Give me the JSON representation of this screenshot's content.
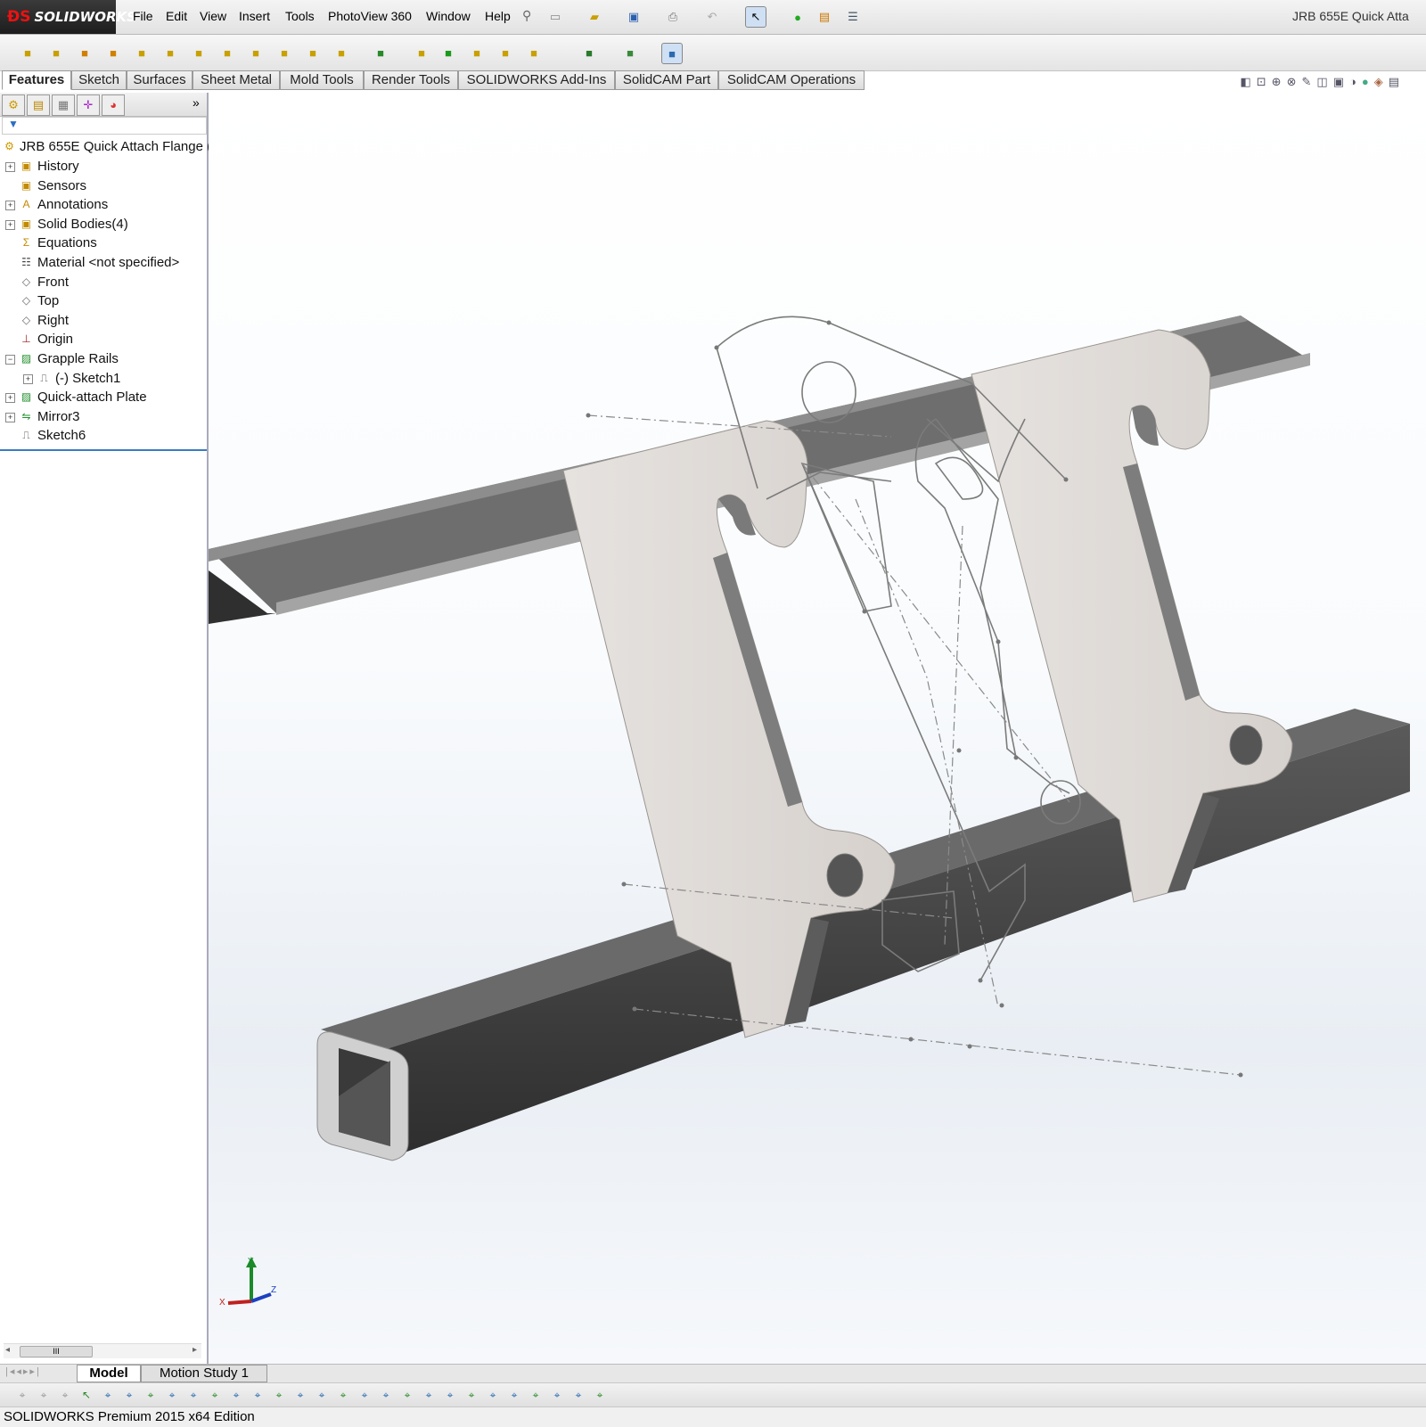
{
  "app": {
    "brand": "SOLIDWORKS",
    "document_title": "JRB 655E Quick Atta"
  },
  "menu": [
    "File",
    "Edit",
    "View",
    "Insert",
    "Tools",
    "PhotoView 360",
    "Window",
    "Help"
  ],
  "command_tabs": [
    "Features",
    "Sketch",
    "Surfaces",
    "Sheet Metal",
    "Mold Tools",
    "Render Tools",
    "SOLIDWORKS Add-Ins",
    "SolidCAM Part",
    "SolidCAM Operations"
  ],
  "feature_tree": {
    "root": "JRB 655E Quick Attach Flange  (",
    "items": [
      {
        "label": "History",
        "icon": "history-folder-icon"
      },
      {
        "label": "Sensors",
        "icon": "sensors-folder-icon"
      },
      {
        "label": "Annotations",
        "icon": "annotations-folder-icon"
      },
      {
        "label": "Solid Bodies(4)",
        "icon": "solid-bodies-folder-icon"
      },
      {
        "label": "Equations",
        "icon": "equations-folder-icon"
      },
      {
        "label": "Material <not specified>",
        "icon": "material-icon"
      },
      {
        "label": "Front",
        "icon": "plane-icon"
      },
      {
        "label": "Top",
        "icon": "plane-icon"
      },
      {
        "label": "Right",
        "icon": "plane-icon"
      },
      {
        "label": "Origin",
        "icon": "origin-icon"
      },
      {
        "label": "Grapple Rails",
        "icon": "feature-icon"
      },
      {
        "label": "(-) Sketch1",
        "icon": "sketch-icon"
      },
      {
        "label": "Quick-attach Plate",
        "icon": "feature-icon"
      },
      {
        "label": "Mirror3",
        "icon": "mirror-icon"
      },
      {
        "label": "Sketch6",
        "icon": "sketch-icon"
      }
    ]
  },
  "triad": {
    "x": "X",
    "y": "Y",
    "z": "Z"
  },
  "bottom_tabs": [
    "Model",
    "Motion Study 1"
  ],
  "scroll_thumb": "III",
  "status": "SOLIDWORKS Premium 2015 x64 Edition"
}
